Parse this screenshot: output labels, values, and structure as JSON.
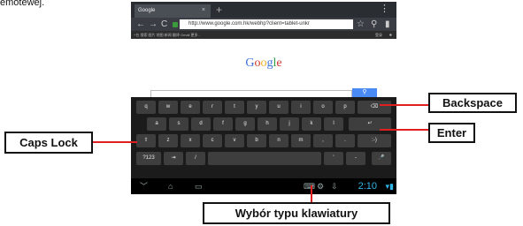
{
  "caption_fragment": "emotewej.",
  "browser": {
    "tab_title": "Google",
    "tab_close": "×",
    "new_tab": "+",
    "menu": "⋮",
    "url": "http://www.google.com.hk/webhp?client=tablet-unkr",
    "gbar_text": "+台  搜索  图片  地图  新闻  翻译  Gmail  更多 -",
    "gbar_right": "登录"
  },
  "page": {
    "logo": "Google"
  },
  "keyboard": {
    "row1": [
      "q",
      "w",
      "e",
      "r",
      "t",
      "y",
      "u",
      "i",
      "o",
      "p"
    ],
    "row2": [
      "a",
      "s",
      "d",
      "f",
      "g",
      "h",
      "j",
      "k",
      "l"
    ],
    "row3": [
      "z",
      "x",
      "c",
      "v",
      "b",
      "n",
      "m",
      ",",
      "."
    ],
    "smiley": ":-)",
    "numbers_key": "?123",
    "slash_key": "/",
    "quote_key": "'",
    "dash_key": "-"
  },
  "status": {
    "clock": "2:10"
  },
  "callouts": {
    "backspace": "Backspace",
    "enter": "Enter",
    "caps_lock": "Caps Lock",
    "keyboard_type": "Wybór typu klawiatury"
  }
}
